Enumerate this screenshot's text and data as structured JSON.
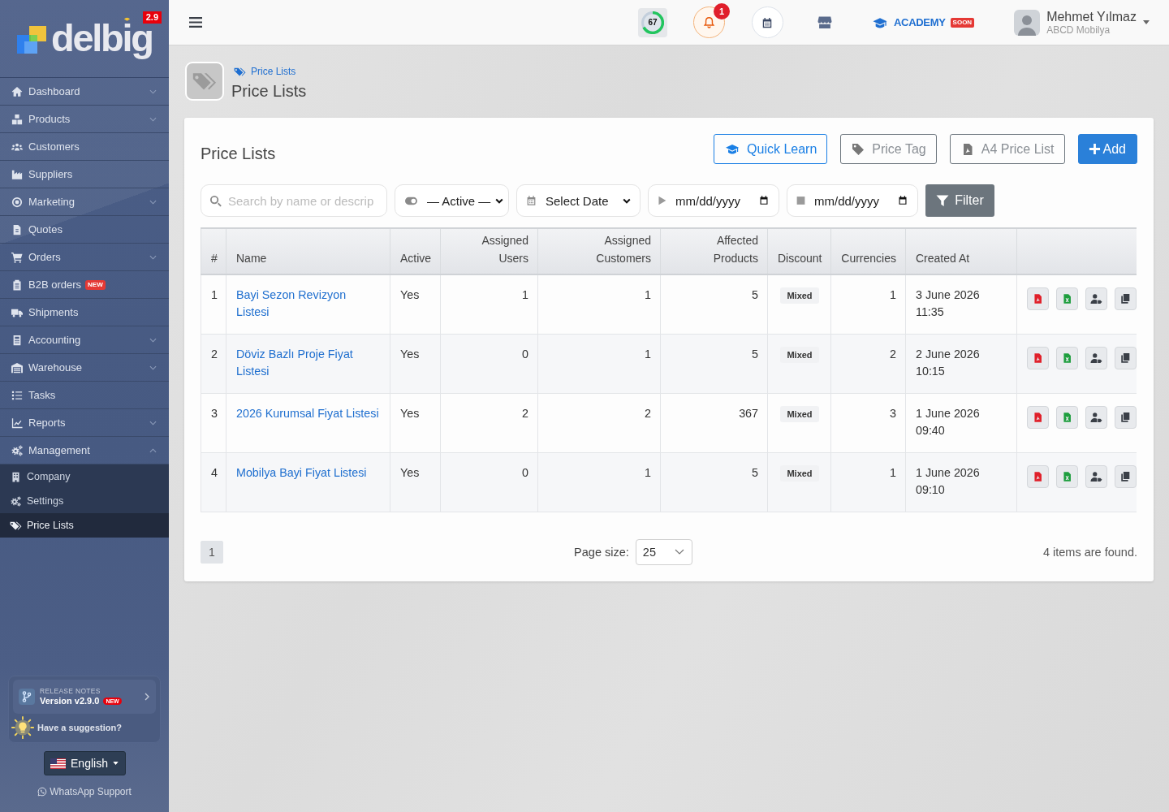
{
  "sidebar": {
    "logo": {
      "text": "delbig",
      "version": "2.9"
    },
    "items": [
      {
        "label": "Dashboard",
        "expanded": false,
        "selected": false
      },
      {
        "label": "Products",
        "expanded": false,
        "selected": false
      },
      {
        "label": "Customers",
        "selected": false
      },
      {
        "label": "Suppliers",
        "selected": false
      },
      {
        "label": "Marketing",
        "expanded": false,
        "selected": false
      },
      {
        "label": "Quotes",
        "selected": false
      },
      {
        "label": "Orders",
        "expanded": false,
        "selected": false
      },
      {
        "label": "B2B orders",
        "badge": "NEW",
        "selected": false
      },
      {
        "label": "Shipments",
        "selected": false
      },
      {
        "label": "Accounting",
        "expanded": false,
        "selected": false
      },
      {
        "label": "Warehouse",
        "expanded": false,
        "selected": false
      },
      {
        "label": "Tasks",
        "selected": false
      },
      {
        "label": "Reports",
        "expanded": false,
        "selected": false
      },
      {
        "label": "Management",
        "expanded": true,
        "selected": false,
        "children": [
          {
            "label": "Company",
            "selected": false
          },
          {
            "label": "Settings",
            "selected": false
          },
          {
            "label": "Price Lists",
            "selected": true
          }
        ]
      }
    ],
    "release_notes": {
      "caption": "RELEASE NOTES",
      "version": "Version v2.9.0",
      "badge": "NEW"
    },
    "suggestion": "Have a suggestion?",
    "language": "English",
    "support_link": "WhatsApp Support"
  },
  "topbar": {
    "score": {
      "value": "67",
      "level": 0.67
    },
    "notifications": {
      "count": "1"
    },
    "academy": {
      "label": "ACADEMY",
      "badge": "SOON"
    },
    "user": {
      "name": "Mehmet Yılmaz",
      "company": "ABCD Mobilya"
    }
  },
  "page_header": {
    "breadcrumb": "Price Lists",
    "title": "Price Lists"
  },
  "card": {
    "title": "Price Lists",
    "buttons": [
      {
        "label": "Quick Learn",
        "kind": "outline-primary"
      },
      {
        "label": "Price Tag",
        "kind": "outline"
      },
      {
        "label": "A4 Price List",
        "kind": "outline"
      },
      {
        "label": "Add",
        "kind": "primary"
      }
    ],
    "filters": {
      "search": {
        "placeholder": "Search by name or descrip"
      },
      "status": {
        "value": "— Active —"
      },
      "date_range": {
        "value": "Select Date"
      },
      "date_from": {
        "placeholder": "mm/dd/yyyy"
      },
      "date_to": {
        "placeholder": "mm/dd/yyyy"
      },
      "filter_button": "Filter"
    },
    "table": {
      "columns": [
        {
          "label": "#",
          "kind": "text"
        },
        {
          "label": "Name",
          "kind": "link"
        },
        {
          "label": "Active",
          "kind": "text"
        },
        {
          "label": "Assigned Users",
          "kind": "number"
        },
        {
          "label": "Assigned Customers",
          "kind": "number"
        },
        {
          "label": "Affected Products",
          "kind": "number"
        },
        {
          "label": "Discount",
          "kind": "badge"
        },
        {
          "label": "Currencies",
          "kind": "number"
        },
        {
          "label": "Created At",
          "kind": "text"
        }
      ],
      "rows": [
        {
          "cells": [
            "1",
            "Bayi Sezon Revizyon Listesi",
            "Yes",
            "1",
            "1",
            "5",
            "Mixed",
            "1",
            "3 June 2026 11:35"
          ]
        },
        {
          "cells": [
            "2",
            "Döviz Bazlı Proje Fiyat Listesi",
            "Yes",
            "0",
            "1",
            "5",
            "Mixed",
            "2",
            "2 June 2026 10:15"
          ]
        },
        {
          "cells": [
            "3",
            "2026 Kurumsal Fiyat Listesi",
            "Yes",
            "2",
            "2",
            "367",
            "Mixed",
            "3",
            "1 June 2026 09:40"
          ]
        },
        {
          "cells": [
            "4",
            "Mobilya Bayi Fiyat Listesi",
            "Yes",
            "0",
            "1",
            "5",
            "Mixed",
            "1",
            "1 June 2026 09:10"
          ]
        }
      ]
    },
    "footer": {
      "pages": [
        {
          "label": "1",
          "selected": true
        }
      ],
      "page_size_label": "Page size:",
      "page_size": "25",
      "summary": "4 items are found."
    }
  }
}
